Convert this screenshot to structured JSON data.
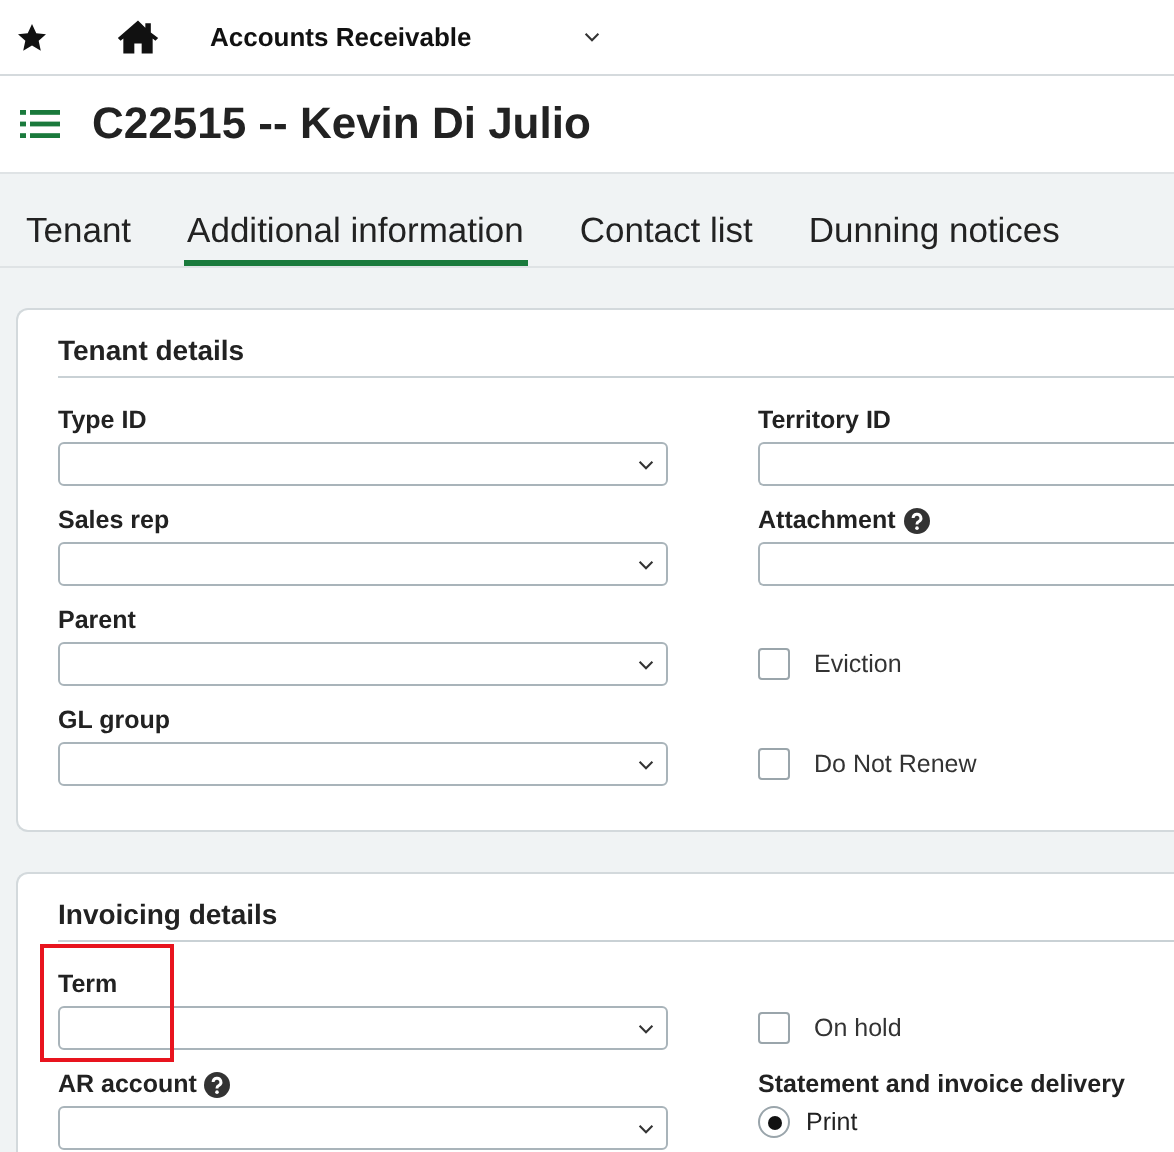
{
  "top_bar": {
    "module": "Accounts Receivable"
  },
  "page_title": "C22515 -- Kevin Di Julio",
  "tabs": [
    {
      "label": "Tenant",
      "selected": false
    },
    {
      "label": "Additional information",
      "selected": true
    },
    {
      "label": "Contact list",
      "selected": false
    },
    {
      "label": "Dunning notices",
      "selected": false
    }
  ],
  "sections": [
    {
      "title": "Tenant details",
      "rows": [
        [
          {
            "kind": "select",
            "label": "Type ID"
          },
          {
            "kind": "input",
            "label": "Territory ID"
          }
        ],
        [
          {
            "kind": "select",
            "label": "Sales rep"
          },
          {
            "kind": "input",
            "label": "Attachment",
            "help": true
          }
        ],
        [
          {
            "kind": "select",
            "label": "Parent"
          },
          {
            "kind": "checkbox",
            "label": "Eviction",
            "checked": false
          }
        ],
        [
          {
            "kind": "select",
            "label": "GL group"
          },
          {
            "kind": "checkbox",
            "label": "Do Not Renew",
            "checked": false
          }
        ]
      ]
    },
    {
      "title": "Invoicing details",
      "rows": [
        [
          {
            "kind": "select",
            "label": "Term",
            "highlighted": true
          },
          {
            "kind": "checkbox",
            "label": "On hold",
            "checked": false
          }
        ],
        [
          {
            "kind": "select",
            "label": "AR account",
            "help": true
          },
          {
            "kind": "radio_group",
            "label": "Statement and invoice delivery",
            "options": [
              {
                "label": "Print",
                "selected": true
              }
            ]
          }
        ]
      ]
    }
  ]
}
